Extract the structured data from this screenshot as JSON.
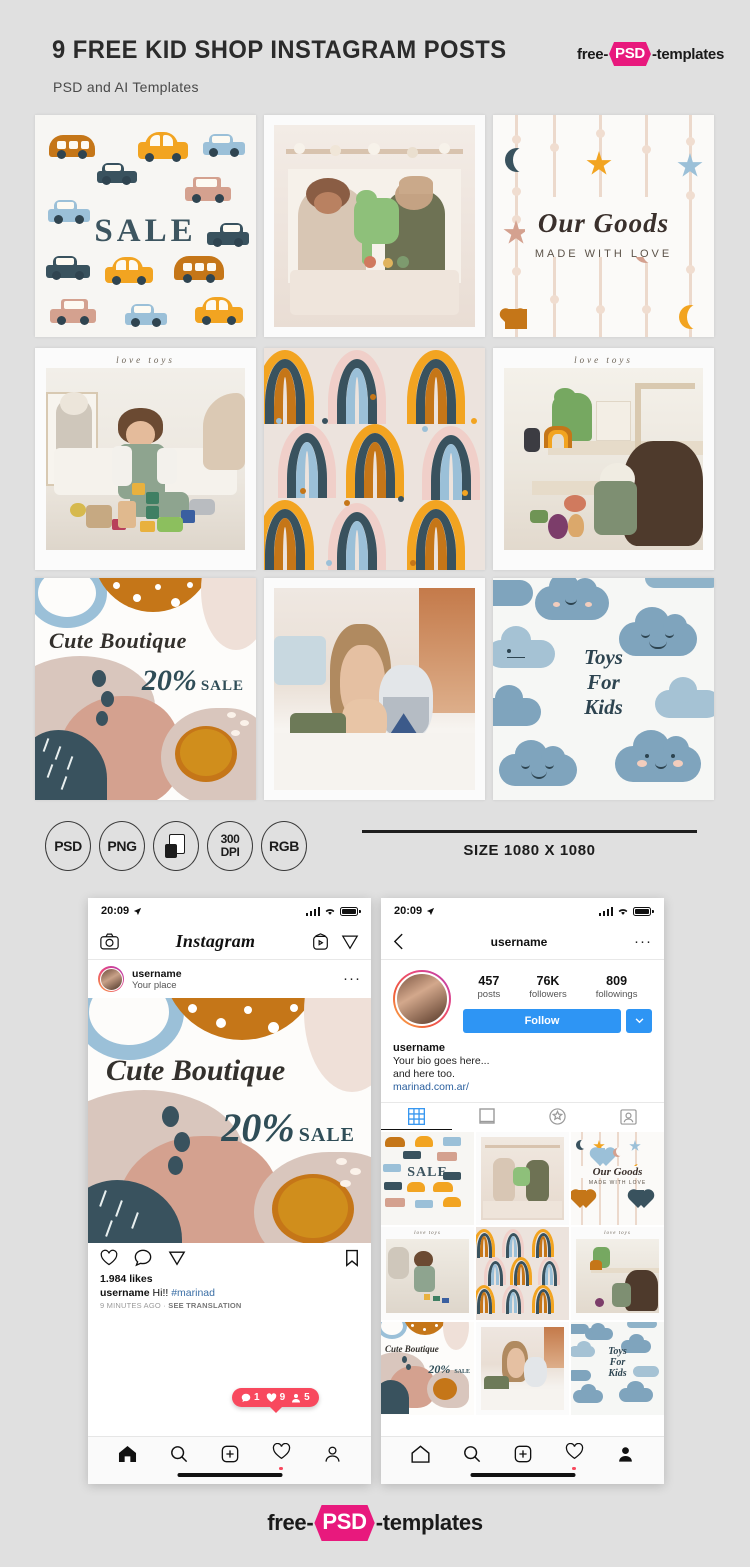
{
  "header": {
    "title": "9 Free Kid Shop Instagram Posts",
    "subtitle": "PSD and AI Templates",
    "logo": {
      "prefix": "free-",
      "badge": "PSD",
      "suffix": "-templates"
    }
  },
  "posts": [
    {
      "id": "post-cars-sale",
      "type": "pattern",
      "title": "SALE"
    },
    {
      "id": "post-girls-dino",
      "type": "photo",
      "title": ""
    },
    {
      "id": "post-our-goods",
      "type": "pattern",
      "title": "Our Goods",
      "subtitle": "MADE WITH LOVE"
    },
    {
      "id": "post-boy-blocks",
      "type": "photo",
      "title": "love toys"
    },
    {
      "id": "post-rainbows",
      "type": "pattern",
      "title": ""
    },
    {
      "id": "post-girl-shelf",
      "type": "photo",
      "title": "love toys"
    },
    {
      "id": "post-cute-boutique",
      "type": "pattern",
      "title": "Cute Boutique",
      "discount": "20%",
      "sale": "SALE"
    },
    {
      "id": "post-girl-drinking",
      "type": "photo",
      "title": ""
    },
    {
      "id": "post-toys-clouds",
      "type": "pattern",
      "title": "Toys\nFor\nKids",
      "lines": [
        "Toys",
        "For",
        "Kids"
      ]
    }
  ],
  "specs": {
    "badges": [
      "PSD",
      "PNG",
      "layers-icon",
      "300\nDPI",
      "RGB"
    ],
    "badge_labels": [
      {
        "line1": "PSD",
        "line2": ""
      },
      {
        "line1": "PNG",
        "line2": ""
      },
      {
        "line1": "",
        "line2": ""
      },
      {
        "line1": "300",
        "line2": "DPI"
      },
      {
        "line1": "RGB",
        "line2": ""
      }
    ],
    "size_text": "SIZE 1080 X 1080"
  },
  "phone_feed": {
    "status": {
      "time": "20:09",
      "location_icon": "location-arrow-icon"
    },
    "appbar": {
      "brand": "Instagram",
      "left_icon": "camera-icon",
      "igtv_icon": "igtv-icon",
      "dm_icon": "direct-message-icon"
    },
    "post_header": {
      "username": "username",
      "place": "Your place",
      "more": "···"
    },
    "engagement": {
      "likes": "1.984 likes",
      "caption_user": "username",
      "caption_text": "Hi!!",
      "caption_tag": "#marinad",
      "time_ago": "9 MINUTES AGO",
      "separator": "·",
      "translate": "SEE TRANSLATION"
    },
    "notification": {
      "comments": "1",
      "likes": "9",
      "followers": "5"
    },
    "tabs": [
      "home-icon",
      "search-icon",
      "add-post-icon",
      "activity-icon",
      "profile-icon"
    ]
  },
  "phone_profile": {
    "status": {
      "time": "20:09",
      "location_icon": "location-arrow-icon"
    },
    "navbar": {
      "back": "back-icon",
      "title": "username",
      "more": "···"
    },
    "stats": [
      {
        "number": "457",
        "label": "posts"
      },
      {
        "number": "76K",
        "label": "followers"
      },
      {
        "number": "809",
        "label": "followings"
      }
    ],
    "follow_button": "Follow",
    "follow_more_icon": "chevron-down-icon",
    "bio": {
      "name": "username",
      "line1": "Your bio goes here...",
      "line2": "and here too.",
      "link": "marinad.com.ar/"
    },
    "tabs": [
      "grid-icon",
      "list-icon",
      "reels-icon",
      "tagged-icon"
    ],
    "active_tab": 0
  },
  "footer": {
    "logo": {
      "prefix": "free-",
      "badge": "PSD",
      "suffix": "-templates"
    }
  },
  "palette": {
    "background": "#e0e0e0",
    "orange": "#f2a421",
    "dark_orange": "#c57618",
    "teal": "#39525e",
    "light_blue": "#9bc0d8",
    "pink": "#f0cfc9",
    "clay": "#d4a18f",
    "cream": "#ece3dd",
    "brand_pink": "#e8197d",
    "ig_blue": "#2e95f4",
    "notif_red": "#f8495e"
  }
}
